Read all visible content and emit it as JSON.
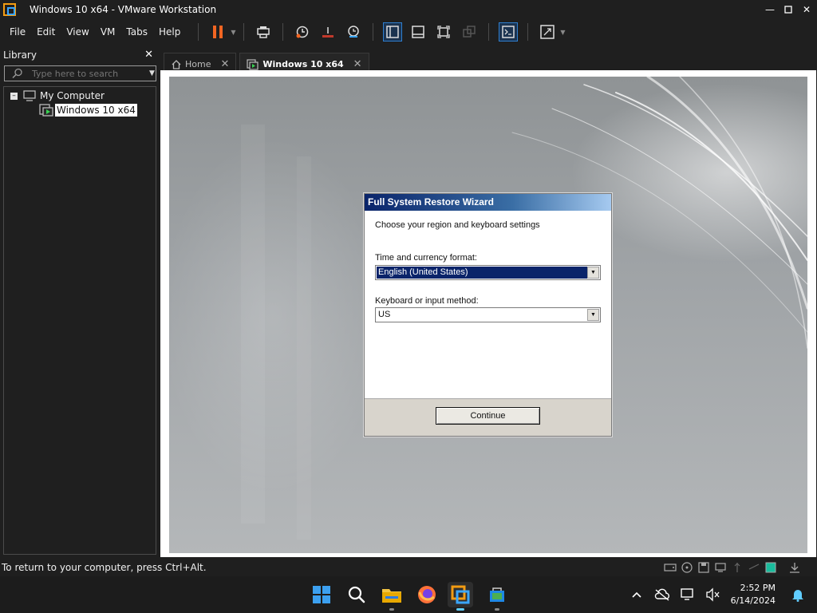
{
  "window": {
    "title": "Windows 10 x64 - VMware Workstation"
  },
  "menu": [
    "File",
    "Edit",
    "View",
    "VM",
    "Tabs",
    "Help"
  ],
  "library": {
    "title": "Library",
    "search_placeholder": "Type here to search",
    "tree": {
      "root": "My Computer",
      "vm": "Windows 10 x64"
    }
  },
  "tabs": [
    {
      "label": "Home",
      "active": false
    },
    {
      "label": "Windows 10 x64",
      "active": true
    }
  ],
  "wizard": {
    "title": "Full System Restore Wizard",
    "subtitle": "Choose your region and keyboard settings",
    "currency_label": "Time and currency format:",
    "currency_value": "English (United States)",
    "keyboard_label": "Keyboard or input method:",
    "keyboard_value": "US",
    "continue_label": "Continue"
  },
  "status": {
    "text": "To return to your computer, press Ctrl+Alt."
  },
  "taskbar": {
    "apps": [
      "start-icon",
      "search-icon",
      "file-explorer-icon",
      "firefox-icon",
      "vmware-icon",
      "store-icon"
    ],
    "time": "2:52 PM",
    "date": "6/14/2024"
  },
  "colors": {
    "accent": "#2f7fd0",
    "pause": "#f26522",
    "wizard_title": "#0a246a"
  }
}
